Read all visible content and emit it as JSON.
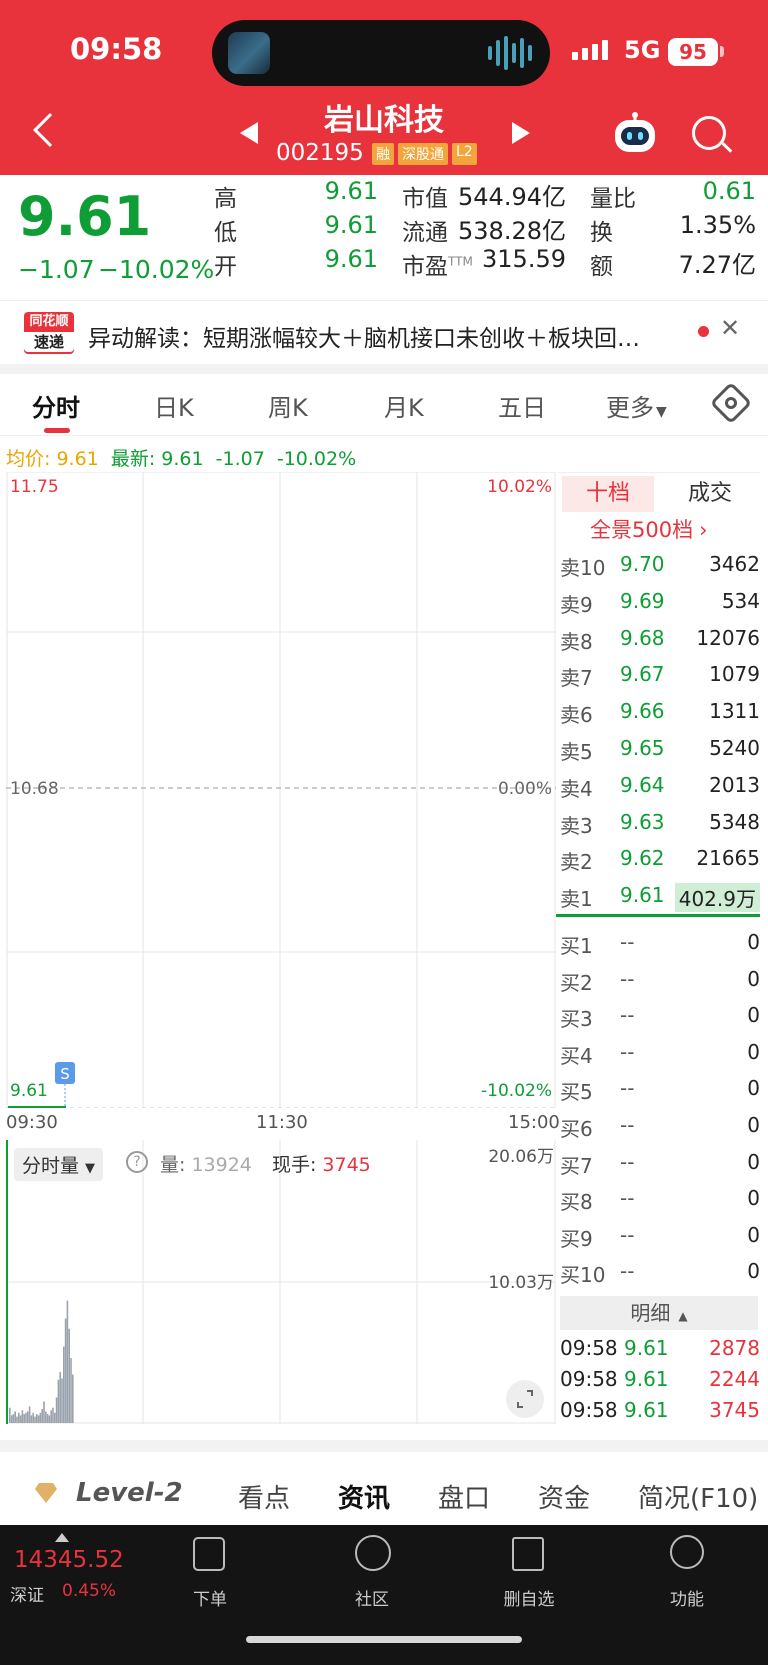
{
  "status_bar": {
    "time": "09:58",
    "network": "5G",
    "battery": "95"
  },
  "stock": {
    "name": "岩山科技",
    "code": "002195",
    "tags": [
      "融",
      "深股通",
      "L2"
    ]
  },
  "quote": {
    "price": "9.61",
    "change": "−1.07",
    "change_pct": "−10.02%",
    "high_label": "高",
    "high": "9.61",
    "low_label": "低",
    "low": "9.61",
    "open_label": "开",
    "open": "9.61",
    "mcap_label": "市值",
    "mcap": "544.94亿",
    "float_label": "流通",
    "float": "538.28亿",
    "pe_label": "市盈",
    "pe_sup": "TTM",
    "pe": "315.59",
    "vr_label": "量比",
    "vr": "0.61",
    "turn_label": "换",
    "turn": "1.35%",
    "amt_label": "额",
    "amt": "7.27亿"
  },
  "news": {
    "logo_top": "同花顺",
    "logo_bottom": "速递",
    "text": "异动解读：短期涨幅较大＋脑机接口未创收＋板块回…",
    "close": "✕"
  },
  "tabs": [
    "分时",
    "日K",
    "周K",
    "月K",
    "五日",
    "更多"
  ],
  "avg_line": {
    "avg_label": "均价:",
    "avg": "9.61",
    "latest_label": "最新:",
    "latest": "9.61",
    "chg": "-1.07",
    "pct": "-10.02%"
  },
  "chart_data": {
    "type": "line",
    "price_axis": {
      "top": "11.75",
      "mid": "10.68",
      "bottom": "9.61"
    },
    "pct_axis": {
      "top": "10.02%",
      "mid": "0.00%",
      "bottom": "-10.02%"
    },
    "time_ticks": [
      "09:30",
      "11:30",
      "15:00"
    ],
    "ylim": [
      9.61,
      11.75
    ],
    "series": [
      {
        "values": [
          9.61,
          9.61,
          9.61,
          9.61,
          9.61
        ]
      }
    ],
    "marker": "S",
    "volume": {
      "title": "分时量",
      "help": "?",
      "vol_label": "量:",
      "vol": "13924",
      "hand_label": "现手:",
      "hand": "3745",
      "axis_top": "20.06万",
      "axis_mid": "10.03万",
      "bars": [
        12,
        6,
        7,
        9,
        5,
        8,
        6,
        10,
        7,
        8,
        9,
        13,
        6,
        8,
        5,
        7,
        6,
        8,
        11,
        17,
        9,
        7,
        6,
        10,
        12,
        8,
        20,
        34,
        40,
        35,
        60,
        82,
        96,
        74,
        51,
        38
      ]
    }
  },
  "orderbook": {
    "tab_active": "十档",
    "tab_other": "成交",
    "link": "全景500档",
    "asks": [
      {
        "label": "卖10",
        "price": "9.70",
        "vol": "3462"
      },
      {
        "label": "卖9",
        "price": "9.69",
        "vol": "534"
      },
      {
        "label": "卖8",
        "price": "9.68",
        "vol": "12076"
      },
      {
        "label": "卖7",
        "price": "9.67",
        "vol": "1079"
      },
      {
        "label": "卖6",
        "price": "9.66",
        "vol": "1311"
      },
      {
        "label": "卖5",
        "price": "9.65",
        "vol": "5240"
      },
      {
        "label": "卖4",
        "price": "9.64",
        "vol": "2013"
      },
      {
        "label": "卖3",
        "price": "9.63",
        "vol": "5348"
      },
      {
        "label": "卖2",
        "price": "9.62",
        "vol": "21665"
      },
      {
        "label": "卖1",
        "price": "9.61",
        "vol": "402.9万"
      }
    ],
    "bids": [
      {
        "label": "买1",
        "price": "--",
        "vol": "0"
      },
      {
        "label": "买2",
        "price": "--",
        "vol": "0"
      },
      {
        "label": "买3",
        "price": "--",
        "vol": "0"
      },
      {
        "label": "买4",
        "price": "--",
        "vol": "0"
      },
      {
        "label": "买5",
        "price": "--",
        "vol": "0"
      },
      {
        "label": "买6",
        "price": "--",
        "vol": "0"
      },
      {
        "label": "买7",
        "price": "--",
        "vol": "0"
      },
      {
        "label": "买8",
        "price": "--",
        "vol": "0"
      },
      {
        "label": "买9",
        "price": "--",
        "vol": "0"
      },
      {
        "label": "买10",
        "price": "--",
        "vol": "0"
      }
    ],
    "detail_label": "明细",
    "trades": [
      {
        "time": "09:58",
        "price": "9.61",
        "vol": "2878"
      },
      {
        "time": "09:58",
        "price": "9.61",
        "vol": "2244"
      },
      {
        "time": "09:58",
        "price": "9.61",
        "vol": "3745"
      }
    ]
  },
  "news_tabs": [
    "Level-2",
    "看点",
    "资讯",
    "盘口",
    "资金",
    "简况(F10)"
  ],
  "dock": {
    "index_value": "14345.52",
    "index_name": "深证",
    "index_pct": "0.45%",
    "items": [
      "下单",
      "社区",
      "删自选",
      "功能"
    ]
  }
}
